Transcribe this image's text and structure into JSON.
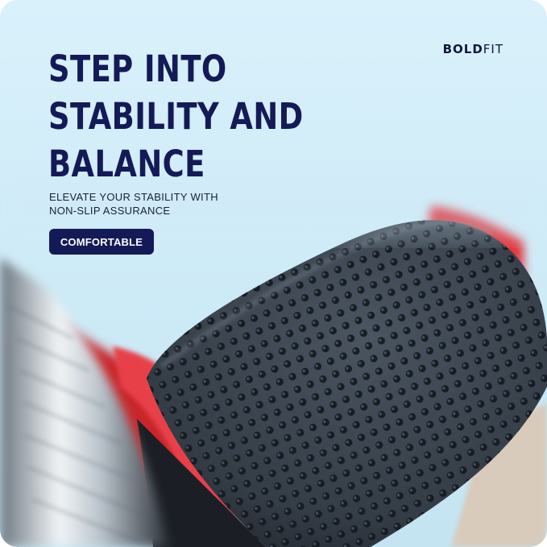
{
  "brand": {
    "bold": "BOLD",
    "light": "FIT"
  },
  "headline": {
    "line1": "STEP INTO",
    "line2": "STABILITY AND",
    "line3": "BALANCE"
  },
  "subline": {
    "line1": "ELEVATE YOUR STABILITY WITH",
    "line2": "NON-SLIP ASSURANCE"
  },
  "badge": {
    "label": "COMFORTABLE"
  },
  "colors": {
    "navy": "#141a57",
    "background": "#d4eefa",
    "grip": "#3a4450",
    "accent_red": "#e2343a"
  }
}
